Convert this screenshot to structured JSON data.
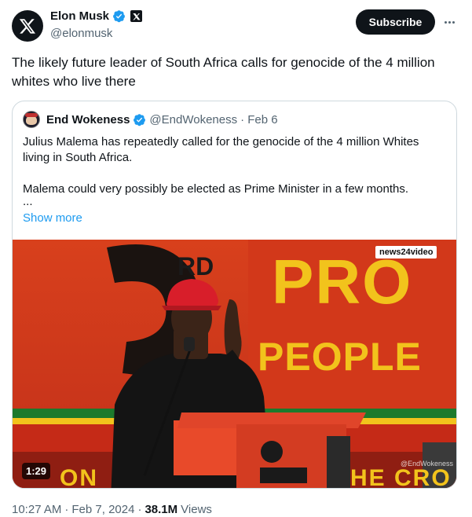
{
  "author": {
    "name": "Elon Musk",
    "handle": "@elonmusk",
    "avatar_icon": "x-logo-icon",
    "verified_icon": "verified-badge-icon",
    "affiliation_icon": "x-affiliation-icon"
  },
  "actions": {
    "subscribe_label": "Subscribe",
    "more_icon": "more-horizontal-icon"
  },
  "tweet": {
    "text": "The likely future leader of South Africa calls for genocide of the 4 million whites who live there"
  },
  "quote": {
    "name": "End Wokeness",
    "handle": "@EndWokeness",
    "date": "· Feb 6",
    "paragraphs": [
      "Julius Malema has repeatedly called for the genocide of the 4 million Whites living in South Africa.",
      "Malema could very possibly be elected as Prime Minister in a few months.",
      "..."
    ],
    "show_more": "Show more",
    "video": {
      "duration": "1:29",
      "source_badge": "news24video",
      "watermark": "@EndWokeness",
      "banner_line1": "PRO",
      "banner_line2": "PEOPLE",
      "ordinal": "RD",
      "bottom_left": "ON",
      "bottom_right": "HE CRO"
    }
  },
  "meta": {
    "time": "10:27 AM",
    "date": "Feb 7, 2024",
    "views_count": "38.1M",
    "views_label": "Views",
    "separator": "·"
  },
  "colors": {
    "accent": "#1d9bf0",
    "text": "#0f1419",
    "muted": "#536471",
    "border": "#cfd9de"
  }
}
